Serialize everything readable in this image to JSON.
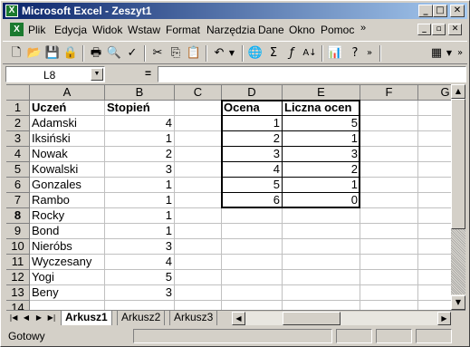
{
  "window": {
    "title": "Microsoft Excel - Zeszyt1",
    "minimize": "_",
    "maximize": "□",
    "close": "✕"
  },
  "menu": {
    "items": [
      "Plik",
      "Edycja",
      "Widok",
      "Wstaw",
      "Format",
      "Narzędzia",
      "Dane",
      "Okno",
      "Pomoc"
    ],
    "overflow": "»"
  },
  "name_box": {
    "value": "L8"
  },
  "formula_bar": {
    "equals": "=",
    "value": ""
  },
  "grid": {
    "columns": [
      "A",
      "B",
      "C",
      "D",
      "E",
      "F",
      "G"
    ],
    "rows": [
      "1",
      "2",
      "3",
      "4",
      "5",
      "6",
      "7",
      "8",
      "9",
      "10",
      "11",
      "12",
      "13",
      "14"
    ],
    "active_row": "8",
    "col_a": [
      "Uczeń",
      "Adamski",
      "Iksiński",
      "Nowak",
      "Kowalski",
      "Gonzales",
      "Rambo",
      "Rocky",
      "Bond",
      "Nieróbs",
      "Wyczesany",
      "Yogi",
      "Beny"
    ],
    "col_b": [
      "Stopień",
      "4",
      "1",
      "2",
      "3",
      "1",
      "1",
      "1",
      "1",
      "3",
      "4",
      "5",
      "3"
    ],
    "col_d": [
      "Ocena",
      "1",
      "2",
      "3",
      "4",
      "5",
      "6"
    ],
    "col_e": [
      "Liczna ocen",
      "5",
      "1",
      "3",
      "2",
      "1",
      "0"
    ]
  },
  "sheets": {
    "tabs": [
      "Arkusz1",
      "Arkusz2",
      "Arkusz3"
    ],
    "active": "Arkusz1"
  },
  "status": {
    "text": "Gotowy"
  },
  "toolbar": {
    "icons": [
      "new-icon",
      "open-icon",
      "save-icon",
      "permission-icon",
      "print-icon",
      "print-preview-icon",
      "spelling-icon",
      "cut-icon",
      "copy-icon",
      "paste-icon",
      "undo-icon",
      "hyperlink-icon",
      "autosum-icon",
      "function-icon",
      "sort-ascending-icon",
      "chart-wizard-icon",
      "help-icon",
      "borders-icon"
    ]
  }
}
